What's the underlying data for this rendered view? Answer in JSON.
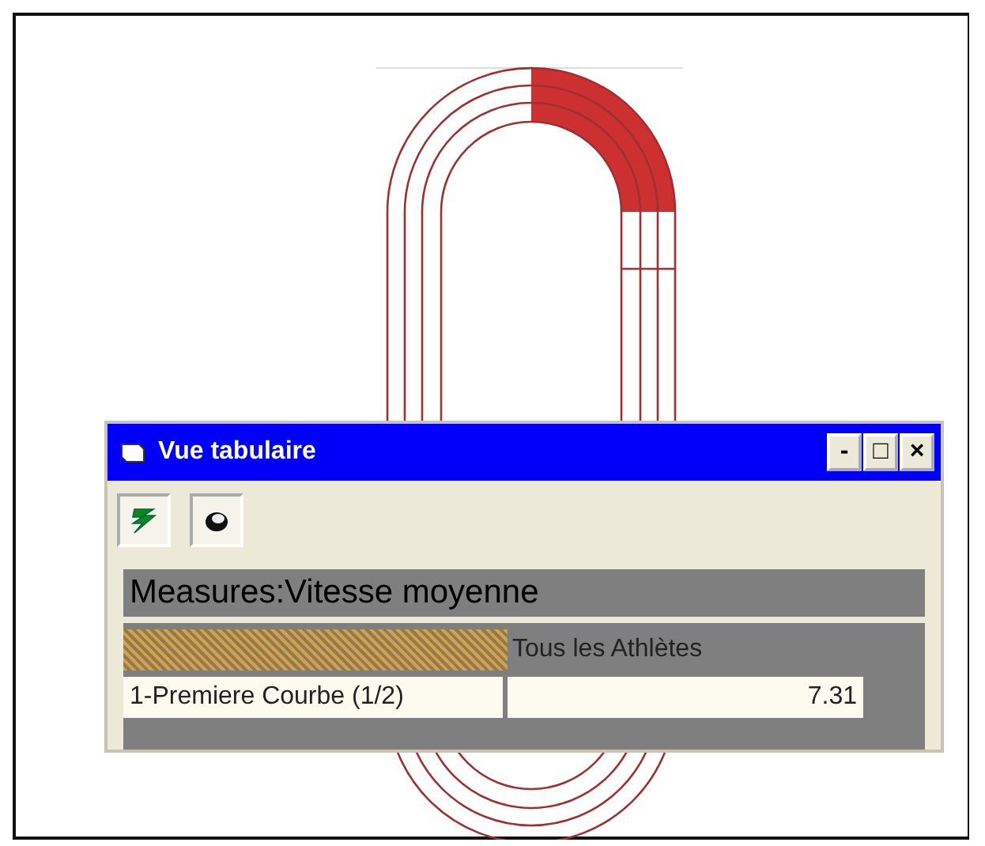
{
  "window": {
    "title": "Vue tabulaire",
    "controls": [
      "-",
      "□",
      "×"
    ]
  },
  "toolbar": [
    {
      "kind": "bolt"
    },
    {
      "kind": "coin"
    }
  ],
  "table": {
    "title": "Measures:Vitesse moyenne",
    "columns": [
      "Tous les Athlètes"
    ],
    "rows": [
      {
        "label": "1-Premiere Courbe (1/2)",
        "values": [
          "7.31"
        ]
      }
    ]
  }
}
